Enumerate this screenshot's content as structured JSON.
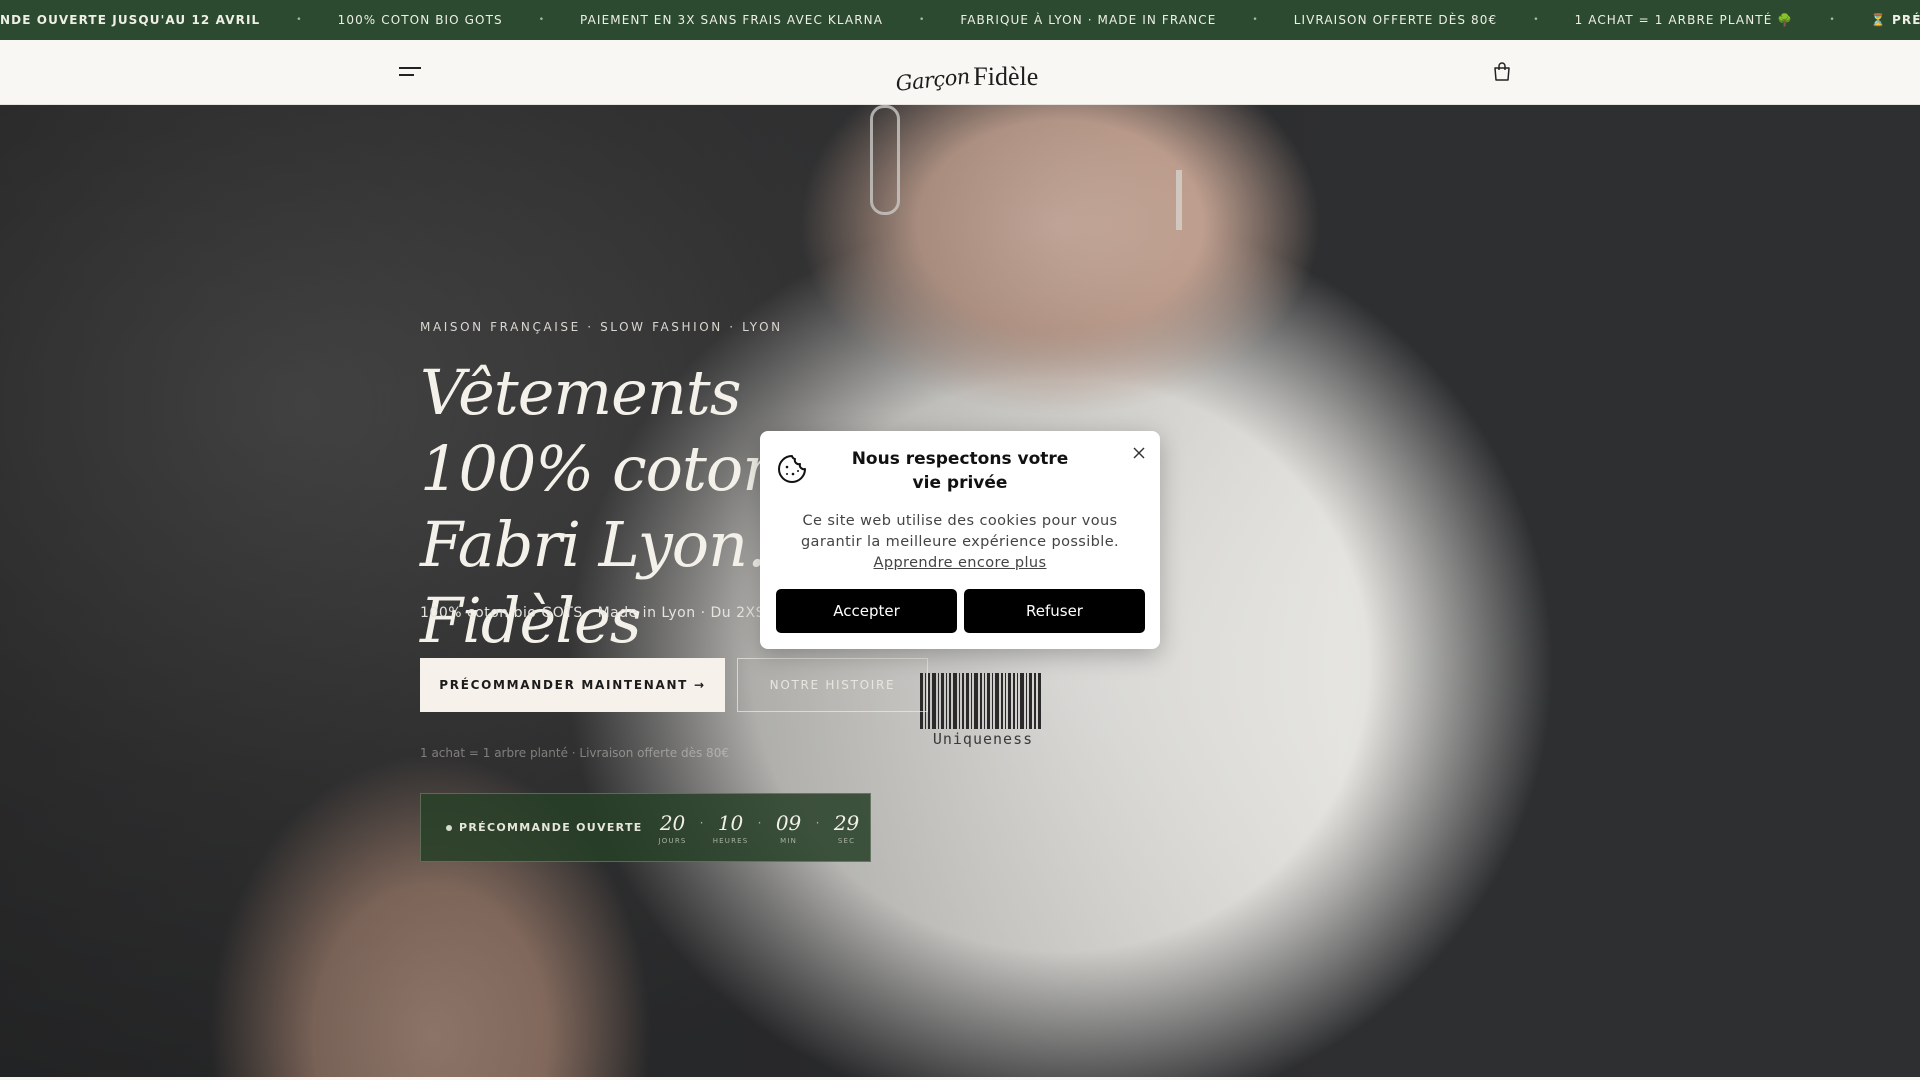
{
  "announcement": {
    "items": [
      {
        "text": "NDE OUVERTE JUSQU'AU 12 AVRIL",
        "bold": true
      },
      {
        "text": "100% COTON BIO GOTS",
        "bold": false
      },
      {
        "text": "PAIEMENT EN 3X SANS FRAIS AVEC KLARNA",
        "bold": false
      },
      {
        "text": "FABRIQUE À LYON · MADE IN FRANCE",
        "bold": false
      },
      {
        "text": "LIVRAISON OFFERTE DÈS 80€",
        "bold": false
      },
      {
        "text": "1 ACHAT = 1 ARBRE PLANTÉ 🌳",
        "bold": false
      },
      {
        "text": "⏳ PRÉCOMMANDE O",
        "bold": true
      }
    ],
    "separator": "•"
  },
  "header": {
    "logo_script": "Garçon",
    "logo_serif": "Fidèle",
    "menu_icon": "hamburger-menu-icon",
    "cart_icon": "shopping-bag-icon"
  },
  "hero": {
    "eyebrow": "MAISON FRANÇAISE · SLOW FASHION · LYON",
    "headline": "Vêtements 100% coton . Fabri Lyon. Fidèles",
    "subline": "100% coton bio GOTS · Made in Lyon · Du 2XS",
    "primary_button": "PRÉCOMMANDER MAINTENANT →",
    "secondary_button": "NOTRE HISTOIRE",
    "small_note": "1 achat = 1 arbre planté · Livraison offerte dès 80€",
    "shirt_print": "Uniqueness"
  },
  "countdown": {
    "status": "PRÉCOMMANDE OUVERTE",
    "units": [
      {
        "value": "20",
        "label": "JOURS"
      },
      {
        "value": "10",
        "label": "HEURES"
      },
      {
        "value": "09",
        "label": "MIN"
      },
      {
        "value": "29",
        "label": "SEC"
      }
    ],
    "separator": "·"
  },
  "cookie": {
    "title": "Nous respectons votre vie privée",
    "text": "Ce site web utilise des cookies pour vous garantir la meilleure expérience possible.",
    "link": "Apprendre encore plus",
    "accept": "Accepter",
    "refuse": "Refuser",
    "icon": "cookie-icon"
  },
  "colors": {
    "announcement_bg": "#2c4a2f",
    "countdown_bg": "#284028",
    "primary_button_bg": "#f6f1ea",
    "cookie_button_bg": "#000000"
  }
}
